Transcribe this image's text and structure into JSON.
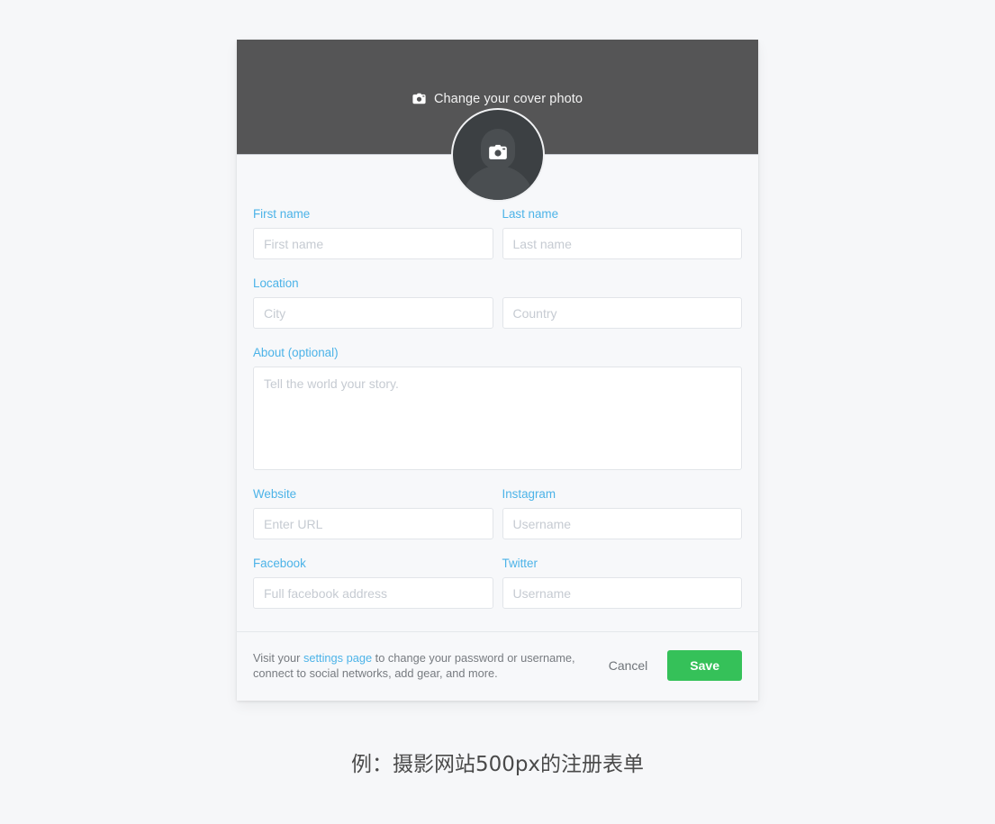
{
  "page": {
    "background_color": "#f6f7f9",
    "caption": "例：摄影网站500px的注册表单"
  },
  "card": {
    "background_color": "#f7f8fa"
  },
  "cover": {
    "background_color": "#555556",
    "cta_label": "Change your cover photo",
    "cta_icon": "camera-icon"
  },
  "avatar": {
    "icon": "camera-icon",
    "background_color": "#3c4043",
    "border_color": "#f1f2f4"
  },
  "theme": {
    "label_color": "#4cb3e8",
    "link_color": "#4cb3e8",
    "save_button_color": "#35c159",
    "input_border_color": "#e2e5e9",
    "placeholder_color": "#c6cbd2"
  },
  "form": {
    "rows": [
      {
        "name": "name-row",
        "fields": [
          {
            "name": "first-name",
            "label": "First name",
            "placeholder": "First name",
            "value": "",
            "type": "text"
          },
          {
            "name": "last-name",
            "label": "Last name",
            "placeholder": "Last name",
            "value": "",
            "type": "text"
          }
        ]
      },
      {
        "name": "location-row",
        "fields": [
          {
            "name": "city",
            "label": "Location",
            "placeholder": "City",
            "value": "",
            "type": "text"
          },
          {
            "name": "country",
            "label": "",
            "placeholder": "Country",
            "value": "",
            "type": "text"
          }
        ]
      },
      {
        "name": "about-row",
        "fields": [
          {
            "name": "about",
            "label": "About (optional)",
            "placeholder": "Tell the world your story.",
            "value": "",
            "type": "textarea"
          }
        ]
      },
      {
        "name": "web-row",
        "fields": [
          {
            "name": "website",
            "label": "Website",
            "placeholder": "Enter URL",
            "value": "",
            "type": "text"
          },
          {
            "name": "instagram",
            "label": "Instagram",
            "placeholder": "Username",
            "value": "",
            "type": "text"
          }
        ]
      },
      {
        "name": "social-row",
        "fields": [
          {
            "name": "facebook",
            "label": "Facebook",
            "placeholder": "Full facebook address",
            "value": "",
            "type": "text"
          },
          {
            "name": "twitter",
            "label": "Twitter",
            "placeholder": "Username",
            "value": "",
            "type": "text"
          }
        ]
      }
    ]
  },
  "footer": {
    "note_prefix": "Visit your ",
    "note_link": "settings page",
    "note_suffix": " to change your password or username, connect to social networks, add gear, and more.",
    "cancel_label": "Cancel",
    "save_label": "Save"
  }
}
